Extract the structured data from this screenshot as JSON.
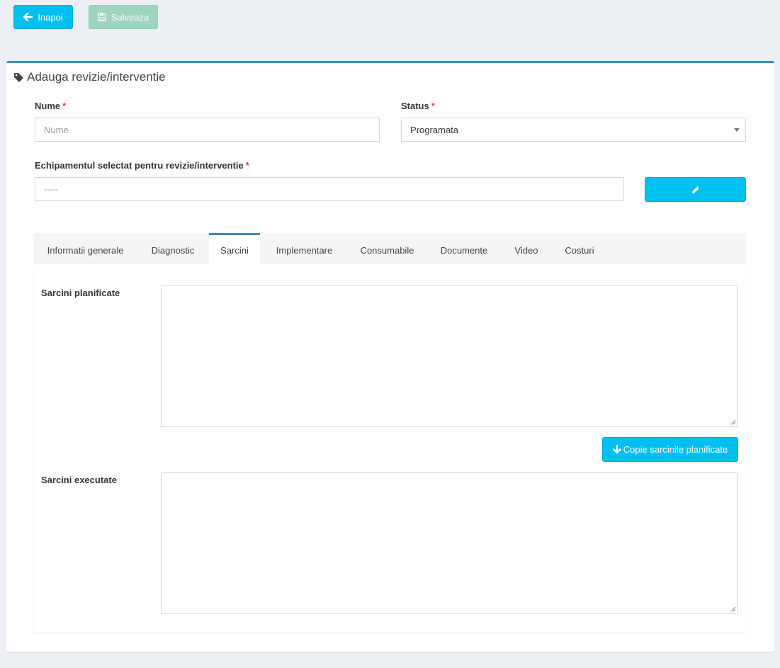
{
  "toolbar": {
    "back_label": "Inapoi",
    "save_label": "Salveaza"
  },
  "box": {
    "title": "Adauga revizie/interventie",
    "title_icon": "tag-icon"
  },
  "form": {
    "nume": {
      "label": "Nume",
      "required_mark": "*",
      "value": "",
      "placeholder": "Nume"
    },
    "status": {
      "label": "Status",
      "required_mark": "*",
      "selected": "Programata"
    },
    "echipament": {
      "label": "Echipamentul selectat pentru revizie/interventie",
      "required_mark": "*",
      "value": "-----",
      "edit_icon": "pencil-icon"
    }
  },
  "tabs": [
    {
      "label": "Informatii generale",
      "active": false
    },
    {
      "label": "Diagnostic",
      "active": false
    },
    {
      "label": "Sarcini",
      "active": true
    },
    {
      "label": "Implementare",
      "active": false
    },
    {
      "label": "Consumabile",
      "active": false
    },
    {
      "label": "Documente",
      "active": false
    },
    {
      "label": "Video",
      "active": false
    },
    {
      "label": "Costuri",
      "active": false
    }
  ],
  "sarcini": {
    "planificate_label": "Sarcini planificate",
    "planificate_value": "",
    "copy_button_label": "Copie sarcinile planificate",
    "executate_label": "Sarcini executate",
    "executate_value": ""
  },
  "colors": {
    "background": "#ecf0f5",
    "info_button": "#00c0ef",
    "save_button_disabled": "#9fd5c0",
    "box_border": "#3c8dbc",
    "required": "#dd4b39"
  }
}
